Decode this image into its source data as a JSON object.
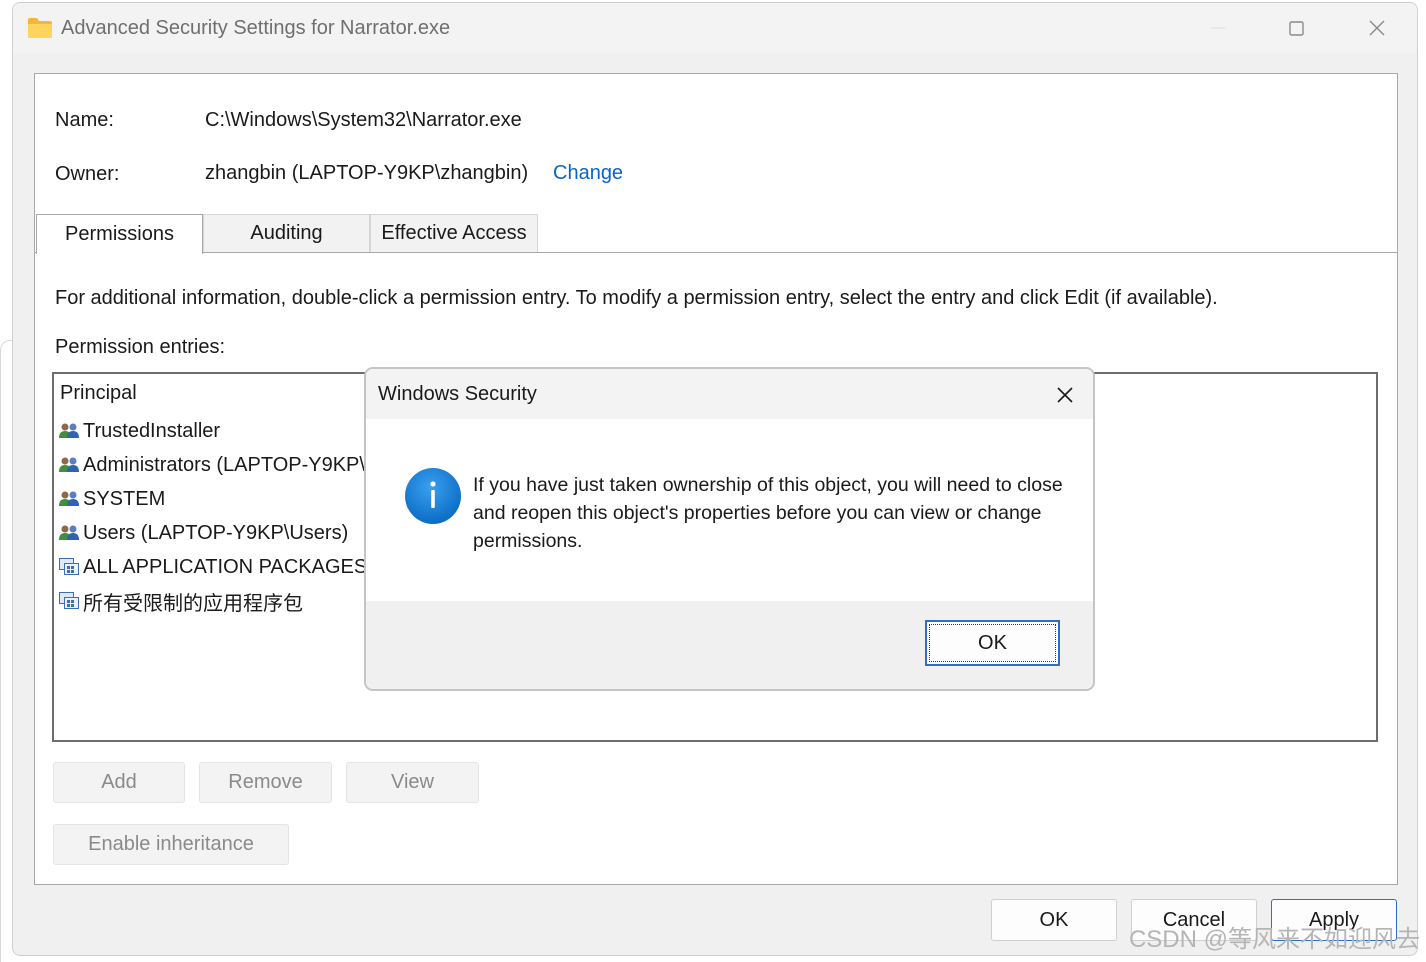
{
  "window": {
    "title": "Advanced Security Settings for Narrator.exe"
  },
  "header": {
    "name_label": "Name:",
    "name_value": "C:\\Windows\\System32\\Narrator.exe",
    "owner_label": "Owner:",
    "owner_value": "zhangbin (LAPTOP-Y9KP\\zhangbin)",
    "change_link": "Change"
  },
  "tabs": [
    {
      "label": "Permissions",
      "active": true
    },
    {
      "label": "Auditing",
      "active": false
    },
    {
      "label": "Effective Access",
      "active": false
    }
  ],
  "permissions": {
    "info_text": "For additional information, double-click a permission entry. To modify a permission entry, select the entry and click Edit (if available).",
    "entries_label": "Permission entries:",
    "column_principal": "Principal",
    "entries": [
      {
        "principal": "TrustedInstaller",
        "icon": "user-group-icon"
      },
      {
        "principal": "Administrators (LAPTOP-Y9KP\\",
        "icon": "user-group-icon"
      },
      {
        "principal": "SYSTEM",
        "icon": "user-group-icon"
      },
      {
        "principal": "Users (LAPTOP-Y9KP\\Users)",
        "icon": "user-group-icon"
      },
      {
        "principal": "ALL APPLICATION PACKAGES",
        "icon": "app-package-icon"
      },
      {
        "principal": "所有受限制的应用程序包",
        "icon": "app-package-icon"
      }
    ],
    "buttons": {
      "add": "Add",
      "remove": "Remove",
      "view": "View",
      "enable_inheritance": "Enable inheritance"
    }
  },
  "footer": {
    "ok": "OK",
    "cancel": "Cancel",
    "apply": "Apply"
  },
  "dialog": {
    "title": "Windows Security",
    "icon": "info-icon",
    "message": "If you have just taken ownership of this object, you will need to close and reopen this object's properties before you can view or change permissions.",
    "ok": "OK"
  },
  "watermark": "CSDN @等风来不如迎风去"
}
